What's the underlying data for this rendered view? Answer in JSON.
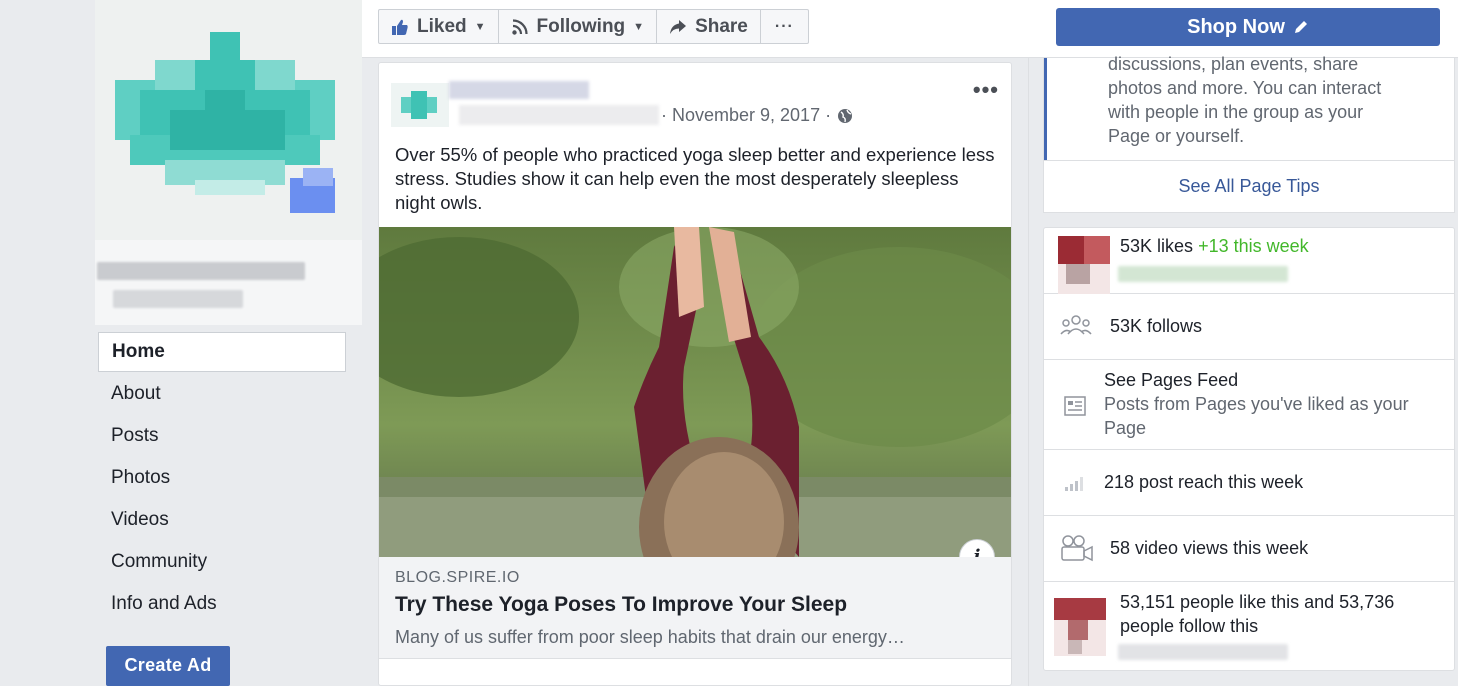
{
  "topbar": {
    "liked_label": "Liked",
    "following_label": "Following",
    "share_label": "Share",
    "more_label": "···",
    "shop_now_label": "Shop Now"
  },
  "nav": {
    "items": [
      {
        "label": "Home",
        "active": true
      },
      {
        "label": "About"
      },
      {
        "label": "Posts"
      },
      {
        "label": "Photos"
      },
      {
        "label": "Videos"
      },
      {
        "label": "Community"
      },
      {
        "label": "Info and Ads"
      }
    ],
    "create_ad_label": "Create Ad"
  },
  "post": {
    "date": "· November 9, 2017 ·",
    "more": "•••",
    "text": "Over 55% of people who practiced yoga sleep better and experience less stress. Studies show it can help even the most desperately sleepless night owls.",
    "link": {
      "domain": "BLOG.SPIRE.IO",
      "title": "Try These Yoga Poses To Improve Your Sleep",
      "description": "Many of us suffer from poor sleep habits that drain our energy…"
    },
    "info_label": "i"
  },
  "tips": {
    "text": "discussions, plan events, share photos and more. You can interact with people in the group as your Page or yourself.",
    "see_all": "See All Page Tips"
  },
  "stats": {
    "likes": "53K likes",
    "likes_delta": "+13 this week",
    "follows": "53K follows",
    "pages_feed_title": "See Pages Feed",
    "pages_feed_sub": "Posts from Pages you've liked as your Page",
    "reach": "218 post reach this week",
    "video_views": "58 video views this week",
    "people": "53,151 people like this and 53,736 people follow this"
  },
  "colors": {
    "brand": "#4267b2",
    "link": "#385898",
    "green": "#42b72a",
    "bg": "#e9ebee"
  }
}
